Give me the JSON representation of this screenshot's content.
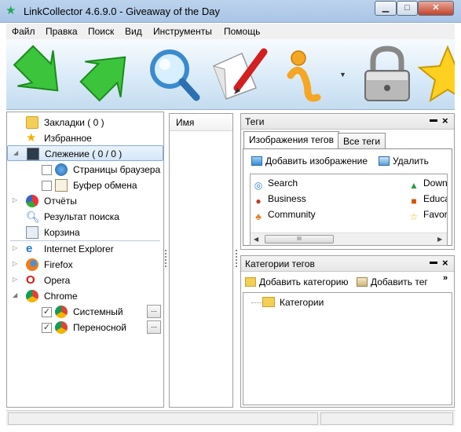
{
  "window": {
    "title": "LinkCollector 4.6.9.0 - Giveaway of the Day"
  },
  "menu": [
    "Файл",
    "Правка",
    "Поиск",
    "Вид",
    "Инструменты",
    "Помощь"
  ],
  "toolbar": {
    "buttons": [
      {
        "icon": "green-arrow-down-icon"
      },
      {
        "icon": "green-arrow-up-icon"
      },
      {
        "icon": "magnifier-icon"
      },
      {
        "icon": "edit-pencil-icon"
      },
      {
        "icon": "info-icon"
      },
      {
        "icon": "lock-icon"
      },
      {
        "icon": "star-icon"
      }
    ]
  },
  "tree": {
    "bookmarks": "Закладки ( 0 )",
    "favorites": "Избранное",
    "tracking": "Слежение ( 0 / 0 )",
    "browser_pages": "Страницы браузера",
    "clipboard": "Буфер обмена",
    "reports": "Отчёты",
    "search_results": "Результат поиска",
    "trash": "Корзина",
    "ie": "Internet Explorer",
    "firefox": "Firefox",
    "opera": "Opera",
    "chrome": "Chrome",
    "system": "Системный",
    "portable": "Переносной",
    "more_label": "..."
  },
  "list": {
    "column_name": "Имя"
  },
  "tags_panel": {
    "title": "Теги",
    "tab_images": "Изображения тегов",
    "tab_all": "Все теги",
    "add_image": "Добавить изображение",
    "delete": "Удалить",
    "tags_left": [
      "Search",
      "Business",
      "Community"
    ],
    "tags_right": [
      "Down",
      "Educa",
      "Favor"
    ],
    "scroll_grip": "III"
  },
  "categories_panel": {
    "title": "Категории тегов",
    "add_category": "Добавить категорию",
    "add_tag": "Добавить тег",
    "overflow": "»",
    "root": "Категории"
  },
  "colors": {
    "titlebar": "#b7cfea",
    "selection": "#d4e6f8",
    "close": "#c1442c"
  }
}
